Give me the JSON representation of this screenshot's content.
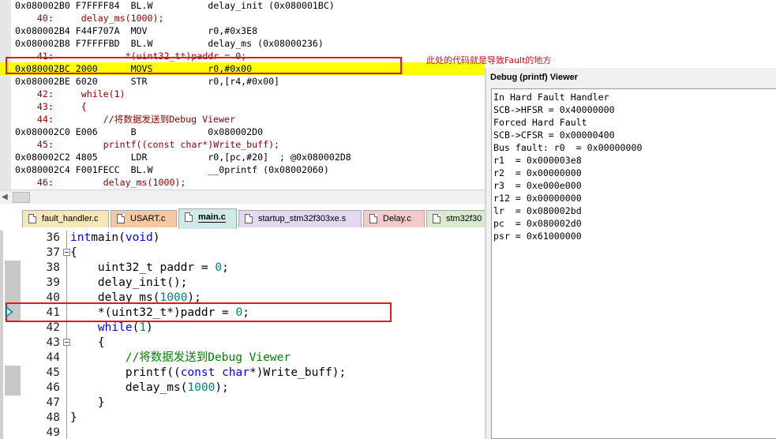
{
  "disassembly": {
    "lines": [
      {
        "text": "0x080002B0 F7FFFF84  BL.W          delay_init (0x080001BC)",
        "type": "asm"
      },
      {
        "text": "    40:     delay_ms(1000);",
        "type": "src"
      },
      {
        "text": "0x080002B4 F44F707A  MOV           r0,#0x3E8",
        "type": "asm"
      },
      {
        "text": "0x080002B8 F7FFFFBD  BL.W          delay_ms (0x08000236)",
        "type": "asm"
      },
      {
        "text": "    41:             *(uint32_t*)paddr = 0;",
        "type": "src"
      },
      {
        "text": "0x080002BC 2000      MOVS          r0,#0x00",
        "type": "cur"
      },
      {
        "text": "0x080002BE 6020      STR           r0,[r4,#0x00]",
        "type": "asm"
      },
      {
        "text": "    42:     while(1)",
        "type": "src"
      },
      {
        "text": "    43:     {",
        "type": "src"
      },
      {
        "text": "    44:         //将数据发送到Debug Viewer",
        "type": "src"
      },
      {
        "text": "0x080002C0 E006      B             0x080002D0",
        "type": "asm"
      },
      {
        "text": "    45:         printf((const char*)Write_buff);",
        "type": "src"
      },
      {
        "text": "0x080002C2 4805      LDR           r0,[pc,#20]  ; @0x080002D8",
        "type": "asm"
      },
      {
        "text": "0x080002C4 F001FECC  BL.W          __0printf (0x08002060)",
        "type": "asm"
      },
      {
        "text": "    46:         delay_ms(1000);",
        "type": "src"
      }
    ],
    "annotation": "此处的代码就是导致Fault的地方"
  },
  "tabs": [
    {
      "label": "fault_handler.c",
      "color": "#f6e7b8",
      "active": false
    },
    {
      "label": "USART.c",
      "color": "#f7c8a0",
      "active": false
    },
    {
      "label": "main.c",
      "color": "#cfe9e6",
      "active": true
    },
    {
      "label": "startup_stm32f303xe.s",
      "color": "#e3d7f2",
      "active": false
    },
    {
      "label": "Delay.c",
      "color": "#f3c9cb",
      "active": false
    },
    {
      "label": "stm32f30",
      "color": "#d8ebcc",
      "active": false
    }
  ],
  "editor": {
    "lines": [
      {
        "num": "36",
        "parts": [
          [
            "kw",
            "int"
          ],
          [
            "",
            "main("
          ],
          [
            "kw",
            "void"
          ],
          [
            "",
            ")"
          ]
        ]
      },
      {
        "num": "37",
        "parts": [
          [
            "",
            "{"
          ]
        ],
        "fold": true
      },
      {
        "num": "38",
        "parts": [
          [
            "",
            "    uint32_t paddr = "
          ],
          [
            "nm",
            "0"
          ],
          [
            "",
            ";"
          ]
        ]
      },
      {
        "num": "39",
        "parts": [
          [
            "",
            "    delay_init();"
          ]
        ]
      },
      {
        "num": "40",
        "parts": [
          [
            "",
            "    delay_ms("
          ],
          [
            "nm",
            "1000"
          ],
          [
            "",
            ");"
          ]
        ]
      },
      {
        "num": "41",
        "parts": [
          [
            "",
            "    *(uint32_t*)paddr = "
          ],
          [
            "nm",
            "0"
          ],
          [
            "",
            ";"
          ]
        ]
      },
      {
        "num": "42",
        "parts": [
          [
            "kw",
            "    while"
          ],
          [
            "",
            "("
          ],
          [
            "nm",
            "1"
          ],
          [
            "",
            ")"
          ]
        ]
      },
      {
        "num": "43",
        "parts": [
          [
            "",
            "    {"
          ]
        ],
        "fold": true
      },
      {
        "num": "44",
        "parts": [
          [
            "cm",
            "        //将数据发送到Debug Viewer"
          ]
        ]
      },
      {
        "num": "45",
        "parts": [
          [
            "",
            "        printf(("
          ],
          [
            "kw",
            "const"
          ],
          [
            "",
            ""
          ],
          [
            "kw",
            " char"
          ],
          [
            "",
            "*)Write_buff);"
          ]
        ]
      },
      {
        "num": "46",
        "parts": [
          [
            "",
            "        delay_ms("
          ],
          [
            "nm",
            "1000"
          ],
          [
            "",
            ");"
          ]
        ]
      },
      {
        "num": "47",
        "parts": [
          [
            "",
            "    }"
          ]
        ]
      },
      {
        "num": "48",
        "parts": [
          [
            "",
            "}"
          ]
        ]
      },
      {
        "num": "49",
        "parts": [
          [
            "",
            ""
          ]
        ]
      }
    ]
  },
  "viewer": {
    "title": "Debug (printf) Viewer",
    "lines": [
      "In Hard Fault Handler",
      "SCB->HFSR = 0x40000000",
      "Forced Hard Fault",
      "SCB->CFSR = 0x00000400",
      "Bus fault: r0  = 0x00000000",
      "r1  = 0x000003e8",
      "r2  = 0x00000000",
      "r3  = 0xe000e000",
      "r12 = 0x00000000",
      "lr  = 0x080002bd",
      "pc  = 0x080002d0",
      "psr = 0x61000000"
    ]
  }
}
